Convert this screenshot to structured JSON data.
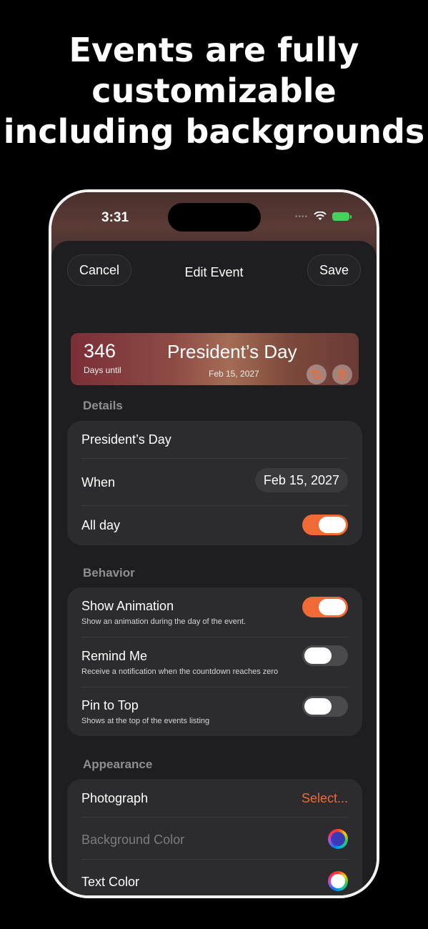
{
  "headline": {
    "line1": "Events are fully",
    "line2": "customizable",
    "line3": "including backgrounds"
  },
  "status": {
    "time": "3:31"
  },
  "nav": {
    "cancel": "Cancel",
    "title": "Edit Event",
    "save": "Save"
  },
  "banner": {
    "count": "346",
    "until": "Days until",
    "name": "President’s Day",
    "date": "Feb 15, 2027"
  },
  "details": {
    "label": "Details",
    "name": "President’s Day",
    "when_label": "When",
    "when_value": "Feb 15, 2027",
    "allday_label": "All day",
    "allday_on": true
  },
  "behavior": {
    "label": "Behavior",
    "items": [
      {
        "title": "Show Animation",
        "sub": "Show an animation during the day of the event.",
        "on": true
      },
      {
        "title": "Remind Me",
        "sub": "Receive a notification when the countdown reaches zero",
        "on": false
      },
      {
        "title": "Pin to Top",
        "sub": "Shows at the top of the events listing",
        "on": false
      }
    ]
  },
  "appearance": {
    "label": "Appearance",
    "photo_label": "Photograph",
    "photo_action": "Select...",
    "bg_label": "Background Color",
    "bg_color": "#3a3ab8",
    "text_label": "Text Color",
    "text_color": "#ffffff"
  },
  "colors": {
    "accent": "#f06a36",
    "toggle_off": "#4a4a4e"
  }
}
